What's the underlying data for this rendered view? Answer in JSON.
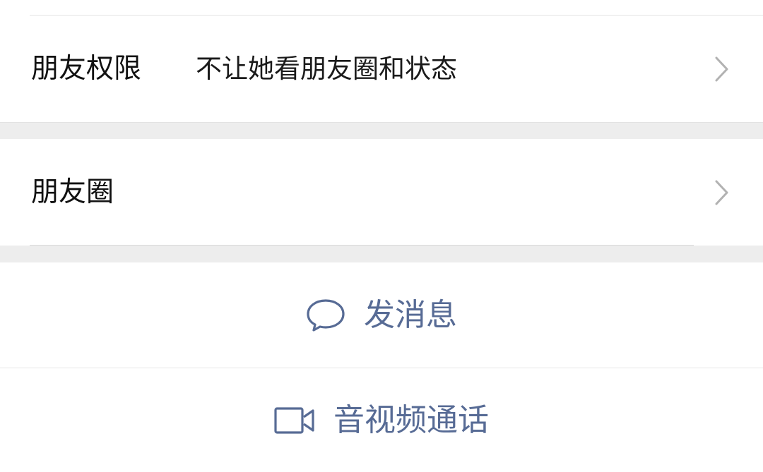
{
  "settings": {
    "permissions": {
      "label": "朋友权限",
      "value": "不让她看朋友圈和状态"
    },
    "moments": {
      "label": "朋友圈"
    }
  },
  "actions": {
    "message": {
      "label": "发消息",
      "icon": "chat-bubble-icon"
    },
    "call": {
      "label": "音视频通话",
      "icon": "video-camera-icon"
    }
  },
  "colors": {
    "action_text": "#576b95",
    "section_gap": "#ededed",
    "chevron": "#b2b2b2"
  }
}
